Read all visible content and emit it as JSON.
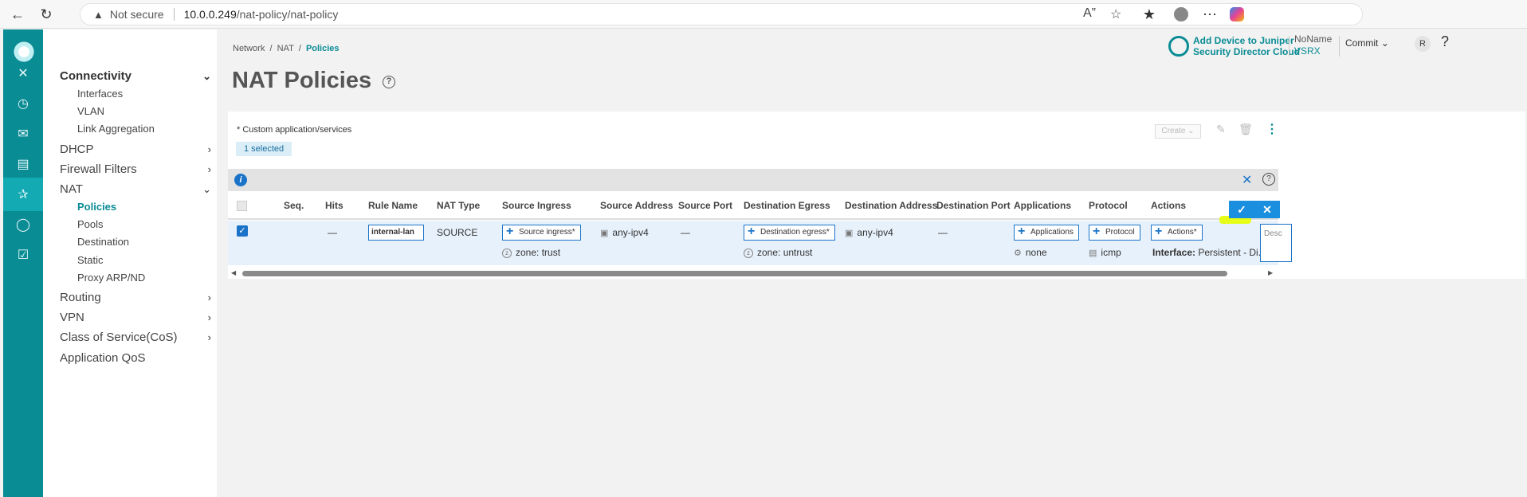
{
  "browser": {
    "back_icon": "back-arrow-icon",
    "reload_icon": "reload-icon",
    "not_secure": "Not secure",
    "url_host": "10.0.0.249",
    "url_path": "/nat-policy/nat-policy"
  },
  "rail": {
    "items": [
      "close-icon",
      "dashboard-icon",
      "monitor-icon",
      "device-icon",
      "network-icon",
      "security-icon",
      "lock-icon"
    ]
  },
  "sidebar": {
    "connectivity": "Connectivity",
    "interfaces": "Interfaces",
    "vlan": "VLAN",
    "link_aggregation": "Link Aggregation",
    "dhcp": "DHCP",
    "firewall_filters": "Firewall Filters",
    "nat": "NAT",
    "policies": "Policies",
    "pools": "Pools",
    "destination": "Destination",
    "static": "Static",
    "proxy_arp": "Proxy ARP/ND",
    "routing": "Routing",
    "vpn": "VPN",
    "cos": "Class of Service(CoS)",
    "app_qos": "Application QoS"
  },
  "header": {
    "crumb_network": "Network",
    "crumb_nat": "NAT",
    "crumb_policies": "Policies",
    "title": "NAT Policies",
    "jsdc_line1": "Add Device to Juniper",
    "jsdc_line2": "Security Director Cloud",
    "noname": "NoName",
    "vsrx": "VSRX",
    "commit": "Commit",
    "avatar": "R",
    "help": "?"
  },
  "toolbar": {
    "custom_note": "* Custom application/services",
    "selected": "1 selected",
    "create": "Create"
  },
  "table": {
    "headers": {
      "seq": "Seq.",
      "hits": "Hits",
      "rule_name": "Rule Name",
      "nat_type": "NAT Type",
      "source_ingress": "Source Ingress",
      "source_address": "Source Address",
      "source_port": "Source Port",
      "destination_egress": "Destination Egress",
      "destination_address": "Destination Address",
      "destination_port": "Destination Port",
      "applications": "Applications",
      "protocol": "Protocol",
      "actions": "Actions"
    },
    "row": {
      "hits": "—",
      "rule_name": "internal-lan",
      "nat_type": "SOURCE",
      "source_ingress_btn": "Source ingress*",
      "source_zone": "zone: trust",
      "source_address": "any-ipv4",
      "source_port": "—",
      "destination_egress_btn": "Destination egress*",
      "destination_zone": "zone: untrust",
      "destination_address": "any-ipv4",
      "destination_port": "—",
      "applications_btn": "Applications",
      "applications_val": "none",
      "protocol_btn": "Protocol",
      "protocol_val": "icmp",
      "actions_btn": "Actions*",
      "interface_label": "Interface:",
      "interface_val": "Persistent - Di...",
      "desc_placeholder": "Desc"
    }
  }
}
